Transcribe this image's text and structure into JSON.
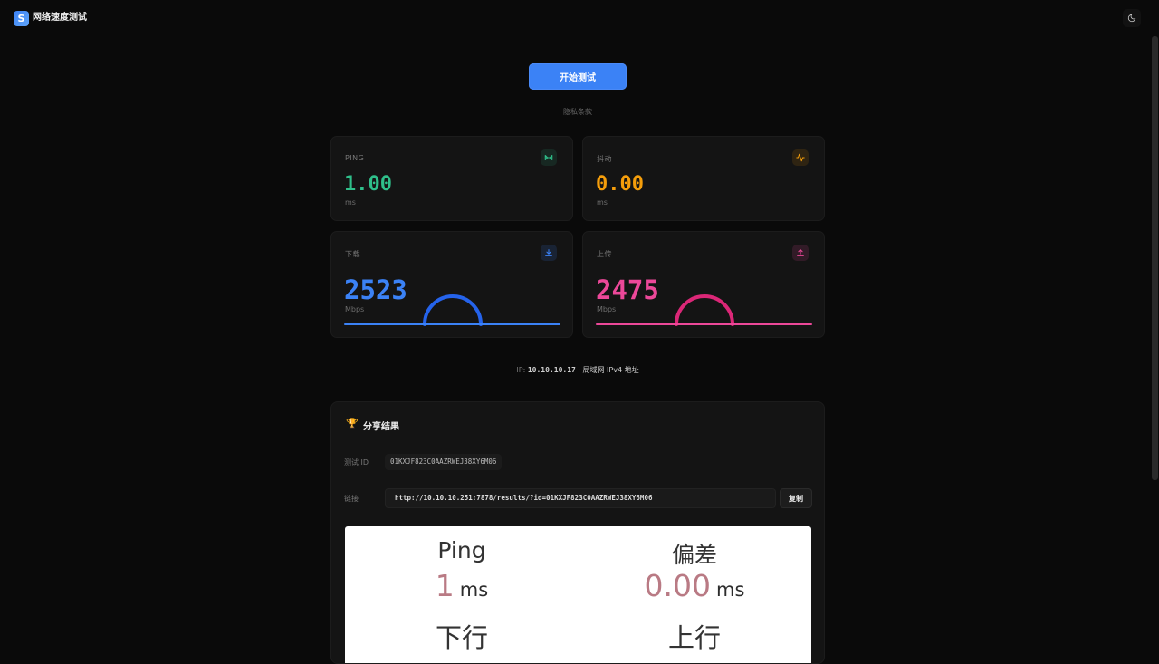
{
  "app": {
    "logo_letter": "S",
    "title": "网络速度测试"
  },
  "theme_toggle": {
    "icon": "moon-icon"
  },
  "start_button": {
    "label": "开始测试"
  },
  "privacy_note": "隐私条款",
  "cards": {
    "ping": {
      "label": "PING",
      "value": "1.00",
      "unit": "ms",
      "icon": "ping-icon",
      "color": "#2fbf8a"
    },
    "jitter": {
      "label": "抖动",
      "value": "0.00",
      "unit": "ms",
      "icon": "activity-icon",
      "color": "#f59e0b"
    },
    "download": {
      "label": "下载",
      "value": "2523",
      "unit": "Mbps",
      "icon": "download-icon",
      "color": "#3b82f6"
    },
    "upload": {
      "label": "上传",
      "value": "2475",
      "unit": "Mbps",
      "icon": "upload-icon",
      "color": "#ec4899"
    }
  },
  "ip_info": {
    "prefix": "IP:",
    "address": "10.10.10.17",
    "separator": "·",
    "network": "局域网 IPv4 地址"
  },
  "share": {
    "title": "分享结果",
    "test_id_label": "测试 ID",
    "test_id": "01KXJF823C0AAZRWEJ38XY6M06",
    "link_label": "链接",
    "link": "http://10.10.10.251:7878/results/?id=01KXJF823C0AAZRWEJ38XY6M06",
    "copy_label": "复制"
  },
  "result_image": {
    "ping_label": "Ping",
    "ping_value": "1",
    "ping_unit": "ms",
    "jitter_label": "偏差",
    "jitter_value": "0.00",
    "jitter_unit": "ms",
    "download_label": "下行",
    "upload_label": "上行"
  }
}
